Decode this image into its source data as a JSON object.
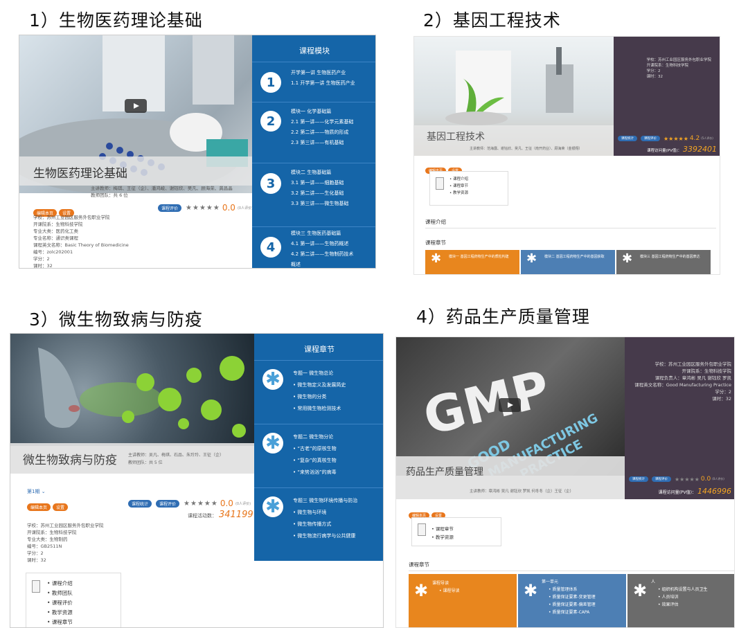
{
  "headings": {
    "h1": "1）生物医药理论基础",
    "h2": "2）基因工程技术",
    "h3": "3）微生物致病与防疫",
    "h4": "4）药品生产质量管理"
  },
  "p1": {
    "course_title": "生物医药理论基础",
    "teachers_line": "主讲教师：梅琪、王征（企）、潘鸿峻、谢钰欣、吴凡、顾海荣、龚昌晶",
    "team_line": "教师团队：共 6 位",
    "tag_edit": "编辑本页",
    "tag_setting": "设置",
    "tag_review": "课程评价",
    "stars": "★★★★★",
    "score": "0.0",
    "score_note": "(0人评价)",
    "info": [
      "学校：苏州工业园区服务外包职业学院",
      "开课院系：生物科技学院",
      "专业大类：医药化工类",
      "专业名称：通识类课程",
      "课程英文名称：Basic Theory of Biomedicine",
      "编号：zolc202001",
      "学分：2",
      "课时：32"
    ],
    "module_header": "课程模块",
    "modules": [
      {
        "num": "1",
        "lines": [
          "开学第一讲 生物医药产业",
          "1.1 开学第一讲 生物医药产业"
        ]
      },
      {
        "num": "2",
        "lines": [
          "模块一 化学基础篇",
          "2.1 第一讲——化学元素基础",
          "2.2 第二讲——物质的形成",
          "2.3 第三讲——有机基础"
        ]
      },
      {
        "num": "3",
        "lines": [
          "模块二 生物基础篇",
          "3.1 第一讲——细胞基础",
          "3.2 第二讲——生化基础",
          "3.3 第三讲——微生物基础"
        ]
      },
      {
        "num": "4",
        "lines": [
          "模块三 生物医药基础篇",
          "4.1 第一讲——生物药概述",
          "4.2 第二讲——生物制药技术",
          "概述"
        ]
      }
    ]
  },
  "p2": {
    "course_title": "基因工程技术",
    "teachers_line": "主讲教师：范海露、谢钰欣、吴凡、王征（南开药业）、顾海荣（金银翔）",
    "info": [
      "学校：苏州工业园区服务外包职业学院",
      "开课院系：生物科技学院",
      "学分：2",
      "课时：32"
    ],
    "tag_stats": "课程统计",
    "tag_review": "课程评价",
    "stars": "★★★★★",
    "score": "4.2",
    "score_note": "(5人评价)",
    "pv_label": "课程访问量(PV值)：",
    "pv": "3392401",
    "tag_edit": "编辑本页",
    "tag_setting": "设置",
    "toc": [
      "课程介绍",
      "课程章节",
      "教学资源"
    ],
    "section_intro": "课程介绍",
    "section_chapters": "课程章节",
    "chapters": [
      "模块一 基因工程药物生产中的质粒构建",
      "模块二 基因工程药物生产中的基因获取",
      "模块三 基因工程药物生产中的基因表达"
    ],
    "star_glyph": "✱"
  },
  "p3": {
    "course_title": "微生物致病与防疫",
    "teachers_line": "主讲教师：吴凡、梅琪、石品、朱玲玲、王征（企）",
    "team_line": "教师团队：共 5 位",
    "term": "第1期",
    "tag_edit": "编辑本页",
    "tag_setting": "设置",
    "tag_stats": "课程统计",
    "tag_review": "课程评价",
    "stars": "★★★★★",
    "score": "0.0",
    "score_note": "(0人评价)",
    "activity_label": "课程活动数：",
    "activity": "341199",
    "info": [
      "学校：苏州工业园区服务外包职业学院",
      "开课院系：生物科技学院",
      "专业大类：生物制药",
      "编号：GB2511N",
      "学分：2",
      "课时：32"
    ],
    "toc": [
      "课程介绍",
      "教师团队",
      "课程评价",
      "教学资源",
      "课程章节"
    ],
    "chapter_header": "课程章节",
    "topics": [
      {
        "title": "专题一 微生物总论",
        "items": [
          "微生物定义及发展简史",
          "微生物的分类",
          "常用微生物检测技术"
        ]
      },
      {
        "title": "专题二 微生物分论",
        "items": [
          "“古老”的原核生物",
          "“复杂”的真核生物",
          "“来势汹汹”的病毒"
        ]
      },
      {
        "title": "专题三 微生物环境传播与防治",
        "items": [
          "微生物与环境",
          "微生物传播方式",
          "微生物流行病学与公共健康"
        ]
      }
    ],
    "star_glyph": "✱"
  },
  "p4": {
    "course_title": "药品生产质量管理",
    "teachers_line": "主讲教师：章鸿彬 吴凡 谢钰欣 罗凯 何冬冬（企）王征（企）",
    "gmp": "GMP",
    "gmp_sub": [
      "GOOD",
      "MANUFACTURING",
      "PRACTICE"
    ],
    "info": [
      "学校：苏州工业园区服务外包职业学院",
      "开课院系：生物科技学院",
      "课程负责人：章鸿彬 吴凡 谢钰欣 罗凯",
      "课程英文名称：Good Manufacturing Practice",
      "学分：2",
      "课时：32"
    ],
    "tag_stats": "课程统计",
    "tag_review": "课程评价",
    "stars": "★★★★★",
    "score": "0.0",
    "score_note": "(0人评价)",
    "pv_label": "课程访问量(PV值)：",
    "pv": "1446996",
    "tag_edit": "编辑本页",
    "tag_setting": "设置",
    "toc": [
      "课程章节",
      "教学资源"
    ],
    "section_chapters": "课程章节",
    "chapters": [
      {
        "title": "课程导读",
        "items": [
          "课程导读"
        ]
      },
      {
        "title": "第一单元",
        "items": [
          "质量管理体系",
          "质量保证要素-变更管理",
          "质量保证要素-偏差管理",
          "质量保证要素-CAPA"
        ]
      },
      {
        "title": "人",
        "items": [
          "组织机构设置与人员卫生",
          "人员培训",
          "效果评估"
        ]
      }
    ],
    "star_glyph": "✱"
  }
}
